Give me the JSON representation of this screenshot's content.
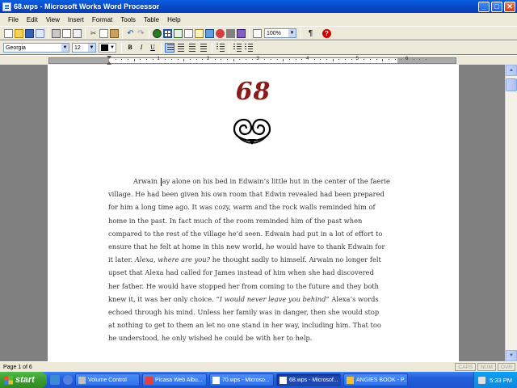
{
  "window": {
    "title": "68.wps - Microsoft Works Word Processor",
    "minimize_glyph": "_",
    "maximize_glyph": "□",
    "close_glyph": "✕"
  },
  "menu": [
    "File",
    "Edit",
    "View",
    "Insert",
    "Format",
    "Tools",
    "Table",
    "Help"
  ],
  "toolbar": {
    "zoom": "100%",
    "paragraph_mark": "¶",
    "help": "?"
  },
  "format_bar": {
    "font": "Georgia",
    "size": "12",
    "bold": "B",
    "italic": "I",
    "underline": "U",
    "font_color": "#000000"
  },
  "ruler": {
    "numbers": [
      "1",
      "2",
      "3",
      "4",
      "5",
      "6"
    ]
  },
  "document": {
    "chapter_number": "68",
    "chapter_color": "#8b1a1a",
    "lines": [
      {
        "pre": "Arwain ",
        "post": "ay alone on his bed in Edwain’s little hut in the center of the faerie",
        "indent": true,
        "cursor": true
      },
      {
        "text": "village. He had been given his own room that Edwin revealed had been prepared"
      },
      {
        "text": "for him a long time ago. It was cozy, warm and the rock walls reminded him of"
      },
      {
        "text": "home in the past. In fact much of the room reminded him of the past when"
      },
      {
        "text": "compared to the rest of the village he’d seen. Edwain had put  in a lot of effort to"
      },
      {
        "text": "ensure that he felt at home in this new world, he would have to thank Edwain for"
      },
      {
        "text": "it later. ",
        "italic": "Alexa, where are you?",
        "post": " he thought sadly to himself. Arwain no longer felt"
      },
      {
        "text": "upset that Alexa had called for James instead of him when she had discovered"
      },
      {
        "text": "her father. He would have stopped her from coming to the future and they both"
      },
      {
        "text": "knew it, it was her only choice. ",
        "italic": "“I would never leave you behind”",
        "post": " Alexa’s words"
      },
      {
        "text": "echoed through his mind. Unless her family was in danger, then she would stop"
      },
      {
        "text": "at nothing to get to them an let no one stand in her way, including him. That too"
      },
      {
        "text": "he understood, he only wished he could be with her to help."
      }
    ]
  },
  "status": {
    "page": "Page 1 of 6",
    "indicators": [
      "CAPS",
      "NUM",
      "OVR"
    ]
  },
  "taskbar": {
    "start": "start",
    "tasks": [
      {
        "label": "Volume Control",
        "icon_color": "#c0c0c0",
        "active": false
      },
      {
        "label": "Picasa Web Albu...",
        "icon_color": "#e04040",
        "active": false
      },
      {
        "label": "70.wps - Microso...",
        "icon_color": "#ffffff",
        "active": false
      },
      {
        "label": "68.wps - Microsof...",
        "icon_color": "#ffffff",
        "active": true
      },
      {
        "label": "ANGIES BOOK - P...",
        "icon_color": "#f4c030",
        "active": false
      }
    ],
    "clock": "5:33 PM"
  }
}
